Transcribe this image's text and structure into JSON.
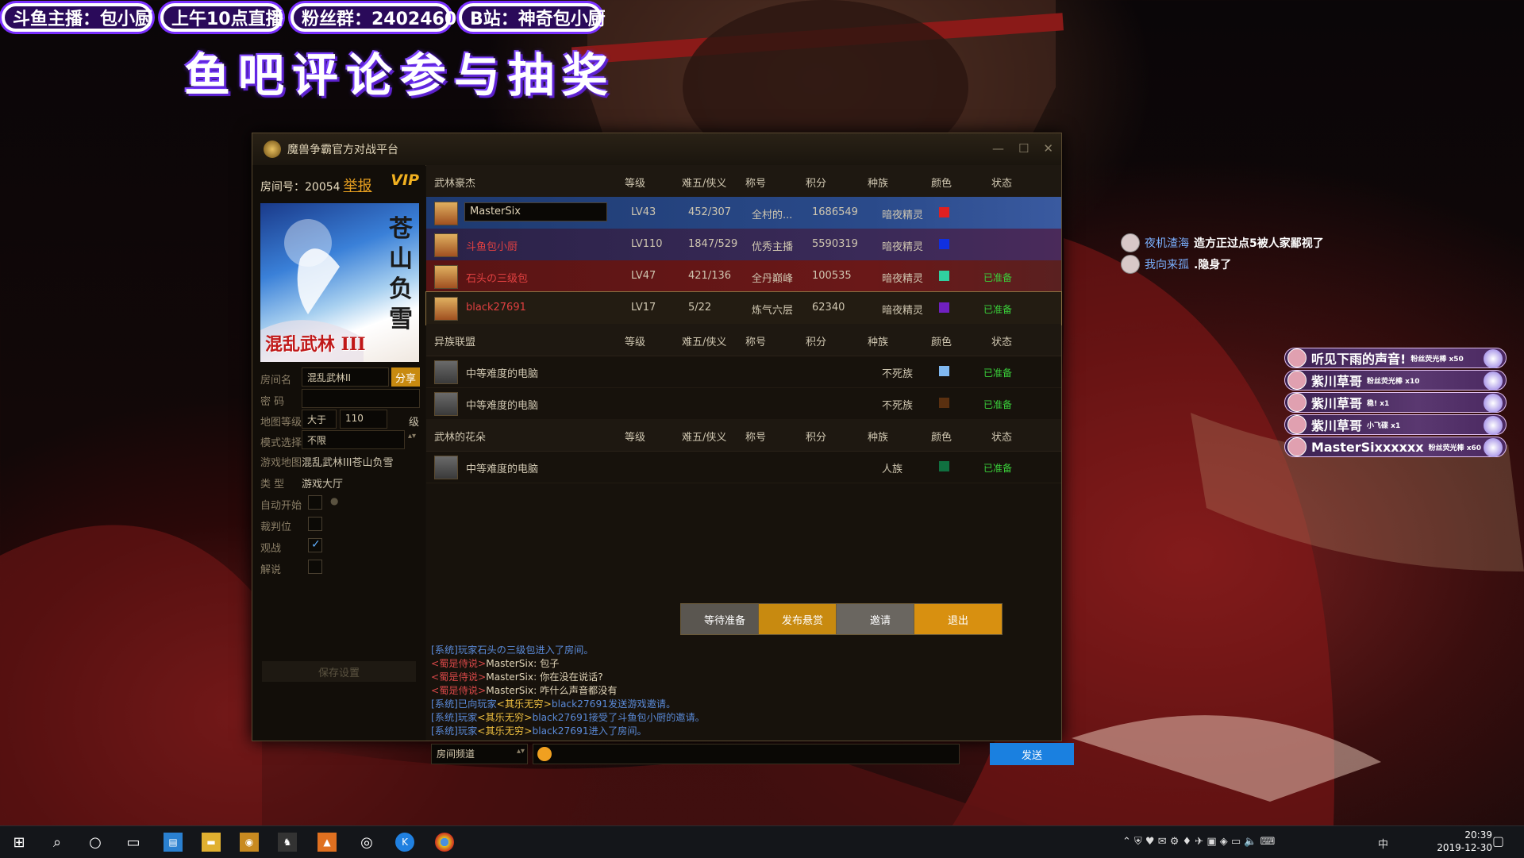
{
  "overlay": {
    "banners": [
      "斗鱼主播：包小厨",
      "上午10点直播",
      "粉丝群：24024600",
      "B站：神奇包小厨"
    ],
    "big_title": "鱼吧评论参与抽奖",
    "danmu": [
      {
        "user": "夜机渣海",
        "text": "造方正过点5被人家鄙视了"
      },
      {
        "user": "我向来孤",
        "text": ".隐身了"
      }
    ],
    "gifts": [
      {
        "user": "听见下雨的声音!",
        "desc": "粉丝荧光棒 x50"
      },
      {
        "user": "紫川草哥",
        "desc": "粉丝荧光棒 x10"
      },
      {
        "user": "紫川草哥",
        "desc": "稳! x1"
      },
      {
        "user": "紫川草哥",
        "desc": "小飞碟 x1"
      },
      {
        "user": "MasterSixxxxxx",
        "desc": "粉丝荧光棒 x60"
      }
    ]
  },
  "window": {
    "title": "魔兽争霸官方对战平台",
    "room_label": "房间号：",
    "room_number": "20054",
    "report": "举报",
    "vip": "VIP",
    "map_vertical": "苍山负雪",
    "map_horizontal": "混乱武林 III",
    "fields": {
      "room_name_label": "房间名",
      "room_name_value": "混乱武林II",
      "share": "分享",
      "password_label": "密 码",
      "map_level_label": "地图等级",
      "map_level_mode": "大于",
      "map_level_value": "110",
      "map_level_unit": "级",
      "mode_label": "模式选择",
      "mode_value": "不限",
      "game_map_label": "游戏地图:",
      "game_map_value": "混乱武林III苍山负雪",
      "type_label": "类 型",
      "type_value": "游戏大厅",
      "auto_start_label": "自动开始",
      "referee_label": "裁判位",
      "spectate_label": "观战",
      "commentary_label": "解说",
      "save": "保存设置"
    },
    "columns": [
      "等级",
      "难五/侠义",
      "称号",
      "积分",
      "种族",
      "颜色",
      "状态"
    ],
    "teams": [
      {
        "name": "武林豪杰",
        "players": [
          {
            "name": "MasterSix",
            "level": "LV43",
            "record": "452/307",
            "title": "全村的...",
            "score": "1686549",
            "race": "暗夜精灵",
            "color": "#e02020",
            "status": "",
            "style": "select"
          },
          {
            "name": "斗鱼包小厨",
            "level": "LV110",
            "record": "1847/529",
            "title": "优秀主播",
            "score": "5590319",
            "race": "暗夜精灵",
            "color": "#1030e0",
            "status": "",
            "style": "blue"
          },
          {
            "name": "石头の三级包",
            "level": "LV47",
            "record": "421/136",
            "title": "全丹巅峰",
            "score": "100535",
            "race": "暗夜精灵",
            "color": "#30d0a0",
            "status": "已准备",
            "style": "red"
          },
          {
            "name": "black27691",
            "level": "LV17",
            "record": "5/22",
            "title": "炼气六层",
            "score": "62340",
            "race": "暗夜精灵",
            "color": "#7020c0",
            "status": "已准备",
            "style": "gold"
          }
        ]
      },
      {
        "name": "异族联盟",
        "players": [
          {
            "name": "中等难度的电脑",
            "level": "",
            "record": "",
            "title": "",
            "score": "",
            "race": "不死族",
            "color": "#80b8f0",
            "status": "已准备",
            "style": "plain"
          },
          {
            "name": "中等难度的电脑",
            "level": "",
            "record": "",
            "title": "",
            "score": "",
            "race": "不死族",
            "color": "#5a3010",
            "status": "已准备",
            "style": "plain"
          }
        ]
      },
      {
        "name": "武林的花朵",
        "players": [
          {
            "name": "中等难度的电脑",
            "level": "",
            "record": "",
            "title": "",
            "score": "",
            "race": "人族",
            "color": "#107040",
            "status": "已准备",
            "style": "plain"
          }
        ]
      }
    ],
    "buttons": {
      "wait": "等待准备",
      "bounty": "发布悬赏",
      "invite": "邀请",
      "exit": "退出"
    },
    "chat": [
      [
        {
          "c": "sys",
          "t": "[系统]玩家石头の三级包进入了房间。"
        }
      ],
      [
        {
          "c": "mine",
          "t": "<蜀是侍说>"
        },
        {
          "c": "txt",
          "t": "MasterSix: 包子"
        }
      ],
      [
        {
          "c": "mine",
          "t": "<蜀是侍说>"
        },
        {
          "c": "txt",
          "t": "MasterSix: 你在没在说话?"
        }
      ],
      [
        {
          "c": "mine",
          "t": "<蜀是侍说>"
        },
        {
          "c": "txt",
          "t": "MasterSix: 咋什么声音都没有"
        }
      ],
      [
        {
          "c": "sys",
          "t": "[系统]已向玩家"
        },
        {
          "c": "gold",
          "t": "<其乐无穷>"
        },
        {
          "c": "sys",
          "t": "black27691发送游戏邀请。"
        }
      ],
      [
        {
          "c": "sys",
          "t": "[系统]玩家"
        },
        {
          "c": "gold",
          "t": "<其乐无穷>"
        },
        {
          "c": "sys",
          "t": "black27691接受了斗鱼包小厨的邀请。"
        }
      ],
      [
        {
          "c": "sys",
          "t": "[系统]玩家"
        },
        {
          "c": "gold",
          "t": "<其乐无穷>"
        },
        {
          "c": "sys",
          "t": "black27691进入了房间。"
        }
      ]
    ],
    "channel": "房间频道",
    "send": "发送"
  },
  "taskbar": {
    "time": "20:39",
    "date": "2019-12-30",
    "ime": "中"
  }
}
